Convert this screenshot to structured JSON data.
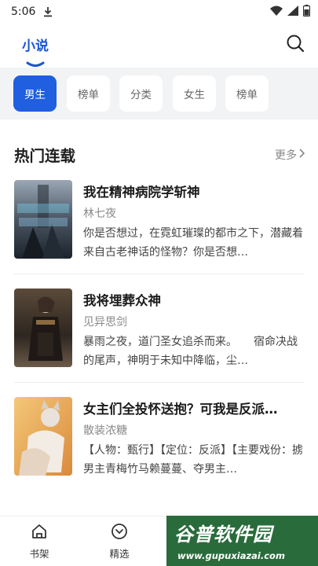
{
  "status_bar": {
    "time": "5:06"
  },
  "header": {
    "tab_label": "小说"
  },
  "chips": [
    {
      "label": "男生",
      "active": true
    },
    {
      "label": "榜单",
      "active": false
    },
    {
      "label": "分类",
      "active": false
    },
    {
      "label": "女生",
      "active": false
    },
    {
      "label": "榜单",
      "active": false
    }
  ],
  "section": {
    "title": "热门连载",
    "more_label": "更多"
  },
  "books": [
    {
      "title": "我在精神病院学斩神",
      "author": "林七夜",
      "desc": "你是否想过，在霓虹璀璨的都市之下，潜藏着来自古老神话的怪物？你是否想…"
    },
    {
      "title": "我将埋葬众神",
      "author": "见异思剑",
      "desc": "暴雨之夜，道门圣女追杀而来。　　宿命决战的尾声，神明于未知中降临，尘…"
    },
    {
      "title": "女主们全投怀送抱？可我是反派…",
      "author": "散装浓糖",
      "desc": "【人物：甄行】【定位：反派】【主要戏份：掳男主青梅竹马赖蔓蔓、夺男主…"
    }
  ],
  "bottom_nav": [
    {
      "label": "书架",
      "icon": "home-icon"
    },
    {
      "label": "精选",
      "icon": "discover-icon"
    }
  ],
  "watermark": {
    "main": "谷普软件园",
    "url": "www.gupuxiazai.com"
  },
  "colors": {
    "accent": "#1f5fe0",
    "band": "#f2f3f5",
    "watermark_bg": "#2a6b3c"
  }
}
